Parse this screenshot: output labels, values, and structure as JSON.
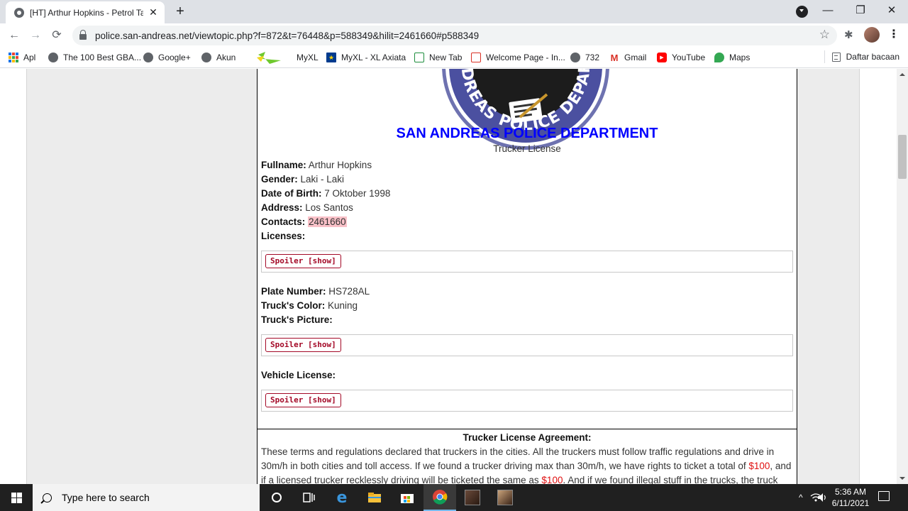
{
  "browser": {
    "tab_title": "[HT] Arthur Hopkins - Petrol Tank",
    "tab_close": "✕",
    "new_tab": "+",
    "url": "police.san-andreas.net/viewtopic.php?f=872&t=76448&p=588349&hilit=2461660#p588349",
    "window": {
      "minimize": "—",
      "restore": "❐",
      "close": "✕"
    }
  },
  "bookmarks": {
    "apps": "Apl",
    "items": [
      {
        "label": "The 100 Best GBA...",
        "icon": "globe-icon"
      },
      {
        "label": "Google+",
        "icon": "globe-icon"
      },
      {
        "label": "Akun",
        "icon": "globe-icon"
      },
      {
        "label": "MyXL",
        "icon": "myxl-icon"
      },
      {
        "label": "MyXL - XL Axiata",
        "icon": "xl-star-icon"
      },
      {
        "label": "New Tab",
        "icon": "newtab-icon"
      },
      {
        "label": "Welcome Page - In...",
        "icon": "home-icon"
      },
      {
        "label": "732",
        "icon": "globe-icon"
      },
      {
        "label": "Gmail",
        "icon": "gmail-icon"
      },
      {
        "label": "YouTube",
        "icon": "youtube-icon"
      },
      {
        "label": "Maps",
        "icon": "maps-icon"
      }
    ],
    "reading_list": "Daftar bacaan"
  },
  "post": {
    "logo_text": "SAN ANDREAS POLICE DEPARTMENT",
    "department": "SAN ANDREAS POLICE DEPARTMENT",
    "license_type": "Trucker License",
    "fields": {
      "fullname_label": "Fullname:",
      "fullname": "Arthur Hopkins",
      "gender_label": "Gender:",
      "gender": "Laki - Laki",
      "dob_label": "Date of Birth:",
      "dob": "7 Oktober 1998",
      "address_label": "Address:",
      "address": "Los Santos",
      "contacts_label": "Contacts:",
      "contacts": "2461660",
      "licenses_label": "Licenses:",
      "plate_label": "Plate Number:",
      "plate": "HS728AL",
      "color_label": "Truck's Color:",
      "color": "Kuning",
      "picture_label": "Truck's Picture:",
      "vehicle_license_label": "Vehicle License:"
    },
    "spoiler_button": "Spoiler [show]"
  },
  "agreement": {
    "title": "Trucker License Agreement:",
    "text_1": "These terms and regulations declared that truckers in the cities. All the truckers must follow traffic regulations and drive in 30m/h in both cities and toll access. If we found a trucker driving max than 30m/h, we have rights to ticket a total of ",
    "amount_1": "$100",
    "text_2": ", and if a licensed trucker recklessly driving will be ticketed the same as ",
    "amount_2": "$100",
    "text_3": ". And if we found illegal stuff in the trucks, the truck"
  },
  "taskbar": {
    "search_placeholder": "Type here to search",
    "time": "5:36 AM",
    "date": "6/11/2021"
  }
}
